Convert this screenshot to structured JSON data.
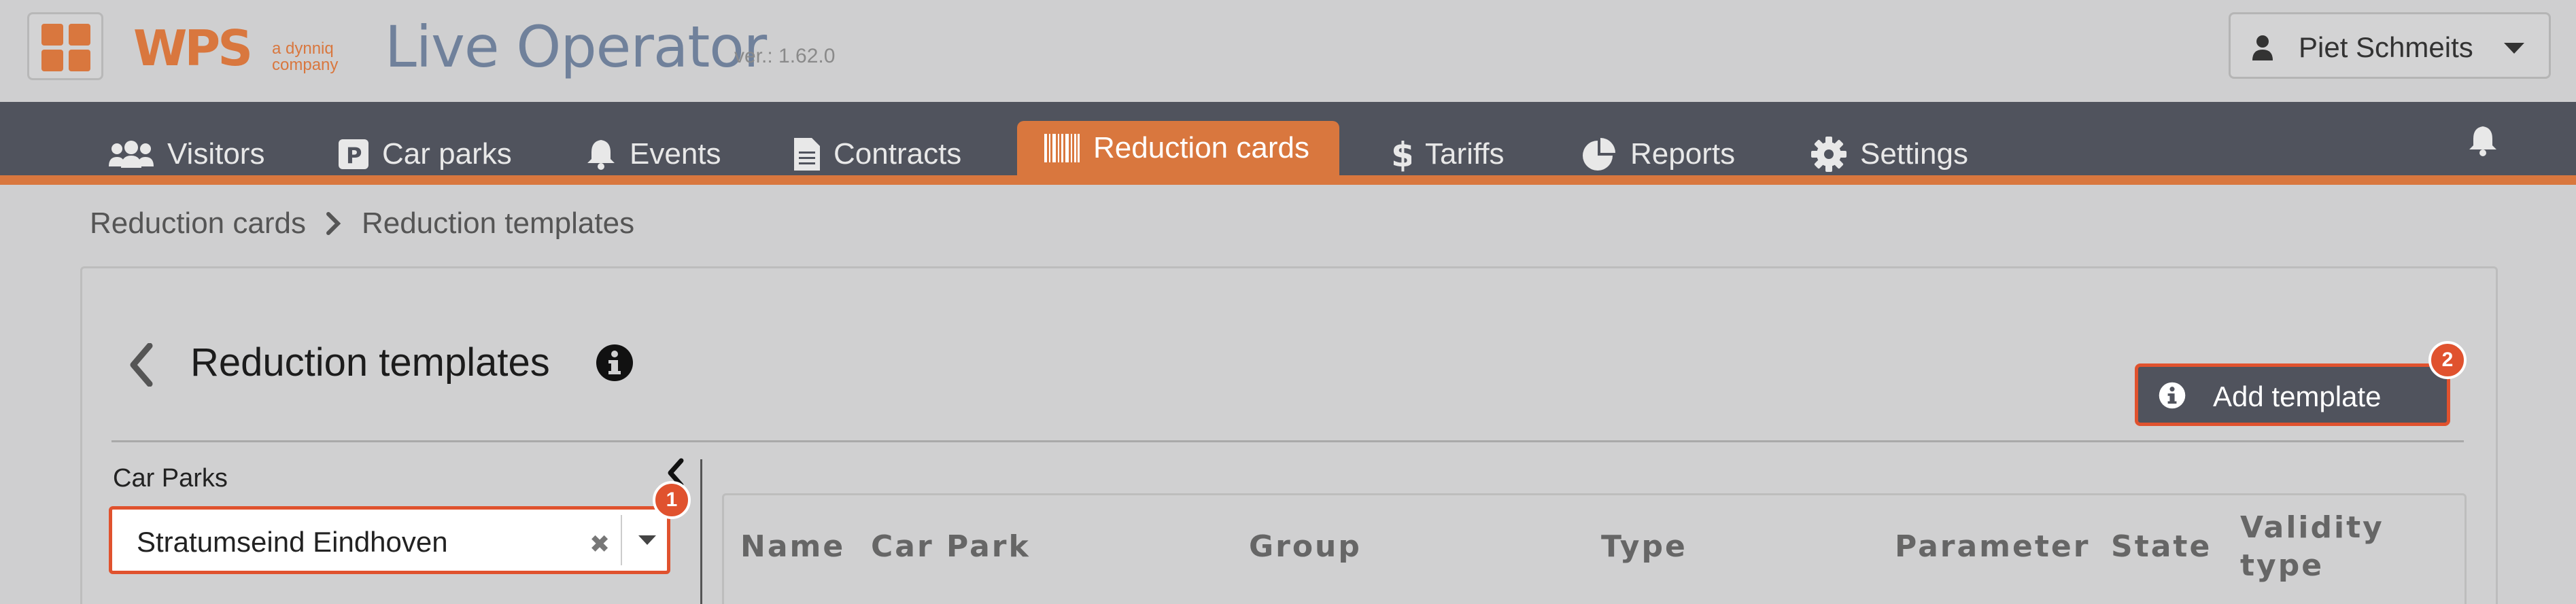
{
  "app": {
    "logo_text": "WPS",
    "company_tagline_1": "a dynniq",
    "company_tagline_2": "company",
    "title": "Live Operator",
    "version": "ver.: 1.62.0"
  },
  "user": {
    "name": "Piet Schmeits"
  },
  "nav": {
    "items": [
      {
        "label": "Visitors",
        "icon": "users-icon"
      },
      {
        "label": "Car parks",
        "icon": "parking-icon"
      },
      {
        "label": "Events",
        "icon": "bell-icon"
      },
      {
        "label": "Contracts",
        "icon": "document-icon"
      },
      {
        "label": "Reduction cards",
        "icon": "barcode-icon",
        "active": true
      },
      {
        "label": "Tariffs",
        "icon": "dollar-icon"
      },
      {
        "label": "Reports",
        "icon": "pie-chart-icon"
      },
      {
        "label": "Settings",
        "icon": "gear-icon"
      }
    ]
  },
  "breadcrumb": {
    "items": [
      "Reduction cards",
      "Reduction templates"
    ]
  },
  "page": {
    "title": "Reduction templates",
    "add_button": "Add template",
    "badge_select": "1",
    "badge_add": "2"
  },
  "filter": {
    "label": "Car Parks",
    "selected": "Stratumseind Eindhoven"
  },
  "table": {
    "columns": [
      "Name",
      "Car Park",
      "Group",
      "Type",
      "Parameter",
      "State",
      "Validity type"
    ]
  },
  "colors": {
    "accent": "#d9773e",
    "nav_bg": "#50535d",
    "highlight": "#e0522e",
    "page_bg": "#cfcfd0"
  }
}
